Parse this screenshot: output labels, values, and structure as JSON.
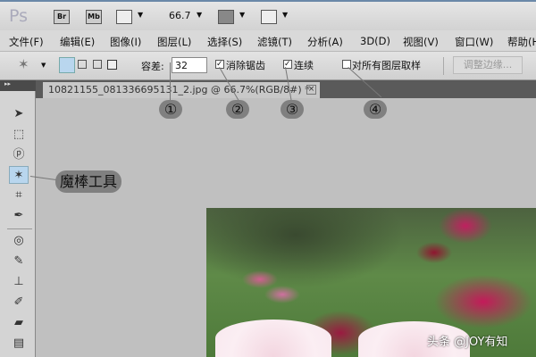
{
  "appbar": {
    "logo": "Ps",
    "br": "Br",
    "mb": "Mb",
    "zoom": "66.7"
  },
  "menu": [
    "文件(F)",
    "编辑(E)",
    "图像(I)",
    "图层(L)",
    "选择(S)",
    "滤镜(T)",
    "分析(A)",
    "3D(D)",
    "视图(V)",
    "窗口(W)",
    "帮助(H)"
  ],
  "options": {
    "tolerance_label": "容差:",
    "tolerance_value": "32",
    "antialias_label": "消除锯齿",
    "antialias_checked": true,
    "contiguous_label": "连续",
    "contiguous_checked": true,
    "sample_all_label": "对所有图层取样",
    "sample_all_checked": false,
    "refine_edge_label": "调整边缘..."
  },
  "document": {
    "tab_title": "10821155_081336695131_2.jpg @ 66.7%(RGB/8#) *",
    "close": "×"
  },
  "callouts": {
    "n1": "①",
    "n2": "②",
    "n3": "③",
    "n4": "④",
    "magic_wand": "魔棒工具"
  },
  "watermark": "头条 @JOY有知"
}
